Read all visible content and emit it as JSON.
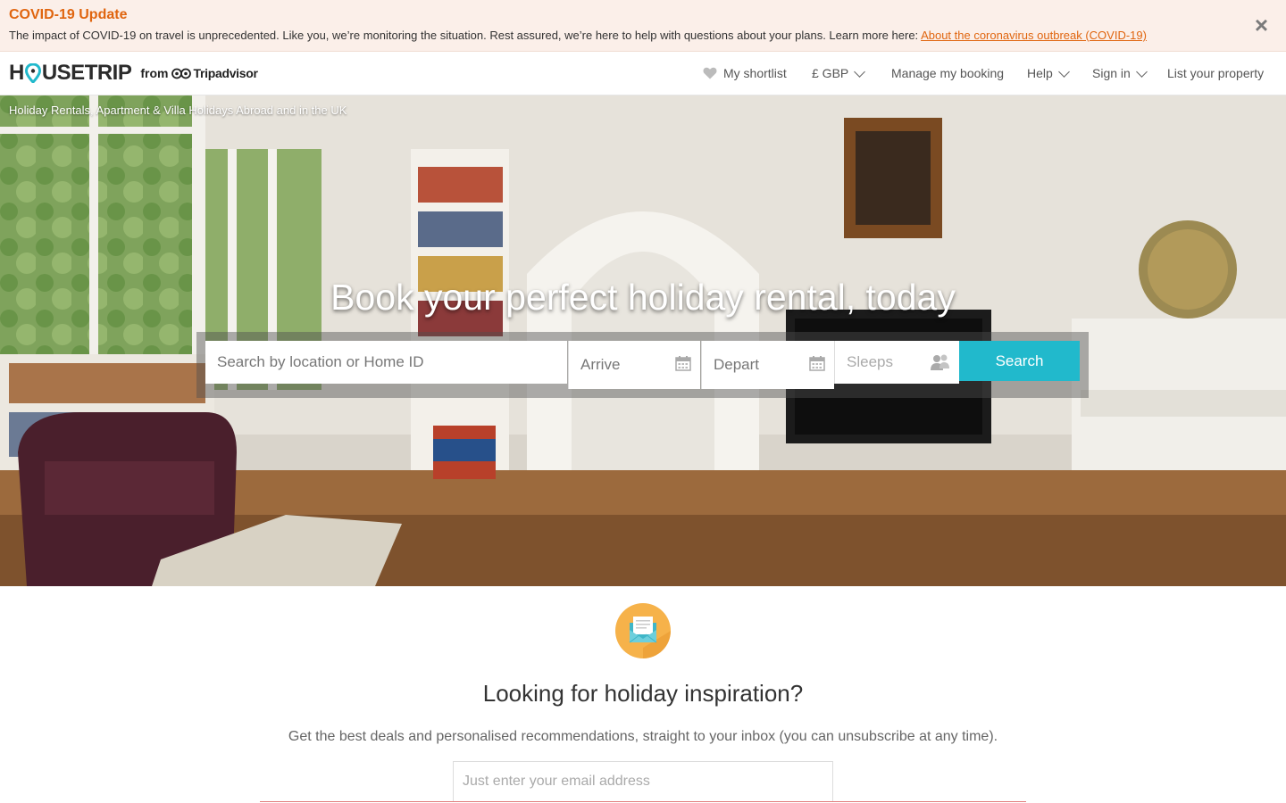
{
  "covid": {
    "title": "COVID-19 Update",
    "text": "The impact of COVID-19 on travel is unprecedented. Like you, we’re monitoring the situation. Rest assured, we’re here to help with questions about your plans. Learn more here: ",
    "link": "About the coronavirus outbreak (COVID-19)",
    "close_icon": "close-icon"
  },
  "header": {
    "logo": {
      "wordmark_left": "H",
      "wordmark_right": "USETRIP",
      "from": "from",
      "partner": "Tripadvisor"
    },
    "nav": {
      "shortlist": "My shortlist",
      "currency": "£ GBP",
      "manage": "Manage my booking",
      "help": "Help",
      "signin": "Sign in",
      "list_property": "List your property"
    }
  },
  "hero": {
    "breadcrumb": "Holiday Rentals, Apartment & Villa Holidays Abroad and in the UK",
    "title": "Book your perfect holiday rental, today",
    "search": {
      "location_placeholder": "Search by location or Home ID",
      "arrive_placeholder": "Arrive",
      "depart_placeholder": "Depart",
      "sleeps_placeholder": "Sleeps",
      "button": "Search"
    }
  },
  "newsletter": {
    "icon": "envelope-icon",
    "title": "Looking for holiday inspiration?",
    "text": "Get the best deals and personalised recommendations, straight to your inbox (you can unsubscribe at any time).",
    "email_placeholder": "Just enter your email address"
  },
  "colors": {
    "accent_orange": "#e0650f",
    "search_button": "#21b9cc",
    "logo_pin": "#21b9cc",
    "newsletter_circle": "#f6b24a"
  }
}
